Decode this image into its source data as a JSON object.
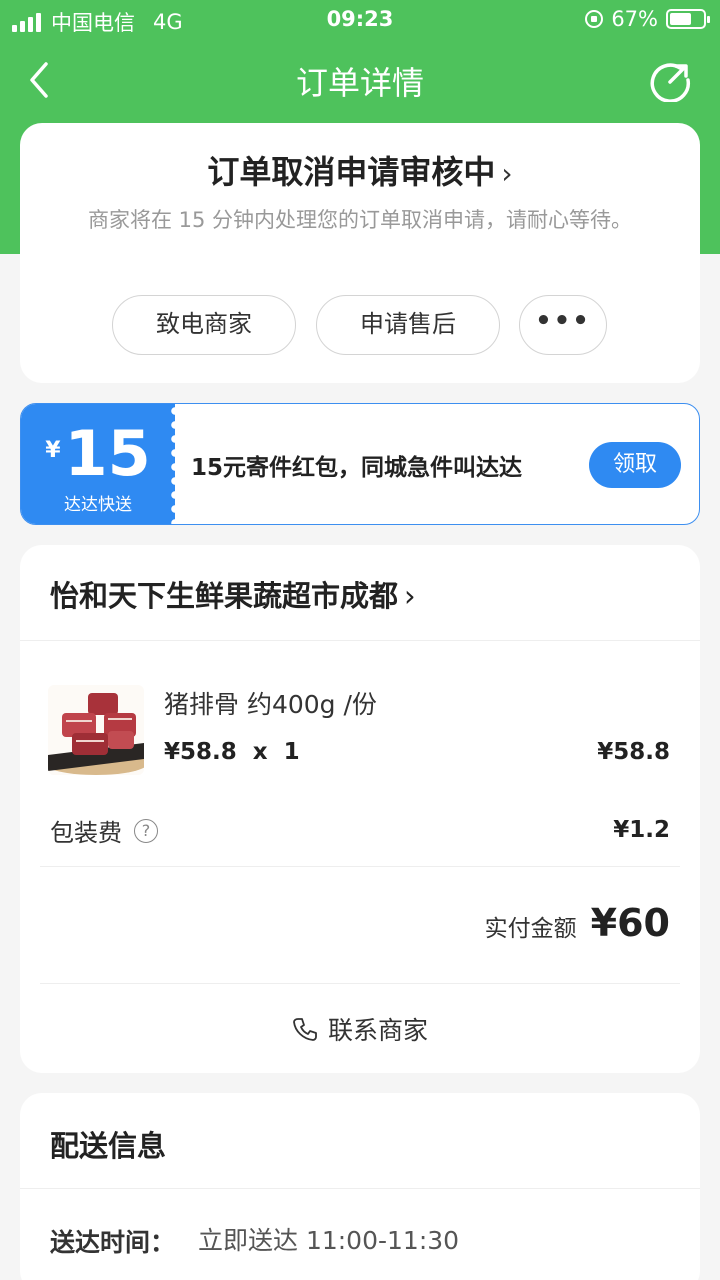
{
  "status_bar": {
    "carrier": "中国电信",
    "network": "4G",
    "time": "09:23",
    "battery_percent": "67%",
    "battery_level": 0.67
  },
  "nav": {
    "title": "订单详情",
    "back_icon": "chevron-left-icon",
    "share_icon": "share-icon"
  },
  "order_status": {
    "title": "订单取消申请审核中",
    "description": "商家将在 15 分钟内处理您的订单取消申请，请耐心等待。",
    "buttons": {
      "call": "致电商家",
      "after_sales": "申请售后",
      "more": "•••"
    }
  },
  "coupon": {
    "currency": "¥",
    "amount": "15",
    "brand": "达达快送",
    "text": "15元寄件红包，同城急件叫达达",
    "button": "领取"
  },
  "shop": {
    "name": "怡和天下生鲜果蔬超市成都"
  },
  "product": {
    "name": "猪排骨 约400g /份",
    "unit_price": "¥58.8",
    "qty_sep": "x",
    "quantity": "1",
    "total": "¥58.8"
  },
  "fees": {
    "packaging_label": "包装费",
    "packaging_value": "¥1.2"
  },
  "payment": {
    "label": "实付金额",
    "value": "¥60"
  },
  "contact": {
    "label": "联系商家"
  },
  "delivery": {
    "title": "配送信息",
    "time_label": "送达时间：",
    "time_value": "立即送达 11:00-11:30"
  },
  "colors": {
    "brand_green": "#4ec25c",
    "coupon_blue": "#2f8af2"
  }
}
